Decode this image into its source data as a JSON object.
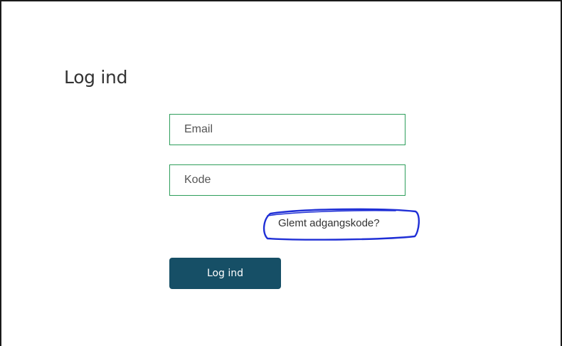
{
  "login": {
    "title": "Log ind",
    "email": {
      "placeholder": "Email",
      "value": ""
    },
    "code": {
      "placeholder": "Kode",
      "value": ""
    },
    "forgot_password_label": "Glemt adgangskode?",
    "submit_label": "Log ind"
  },
  "colors": {
    "field_border": "#2e9e5b",
    "button_background": "#164f66",
    "button_text": "#ffffff",
    "annotation_ink": "#1f2fd6"
  }
}
